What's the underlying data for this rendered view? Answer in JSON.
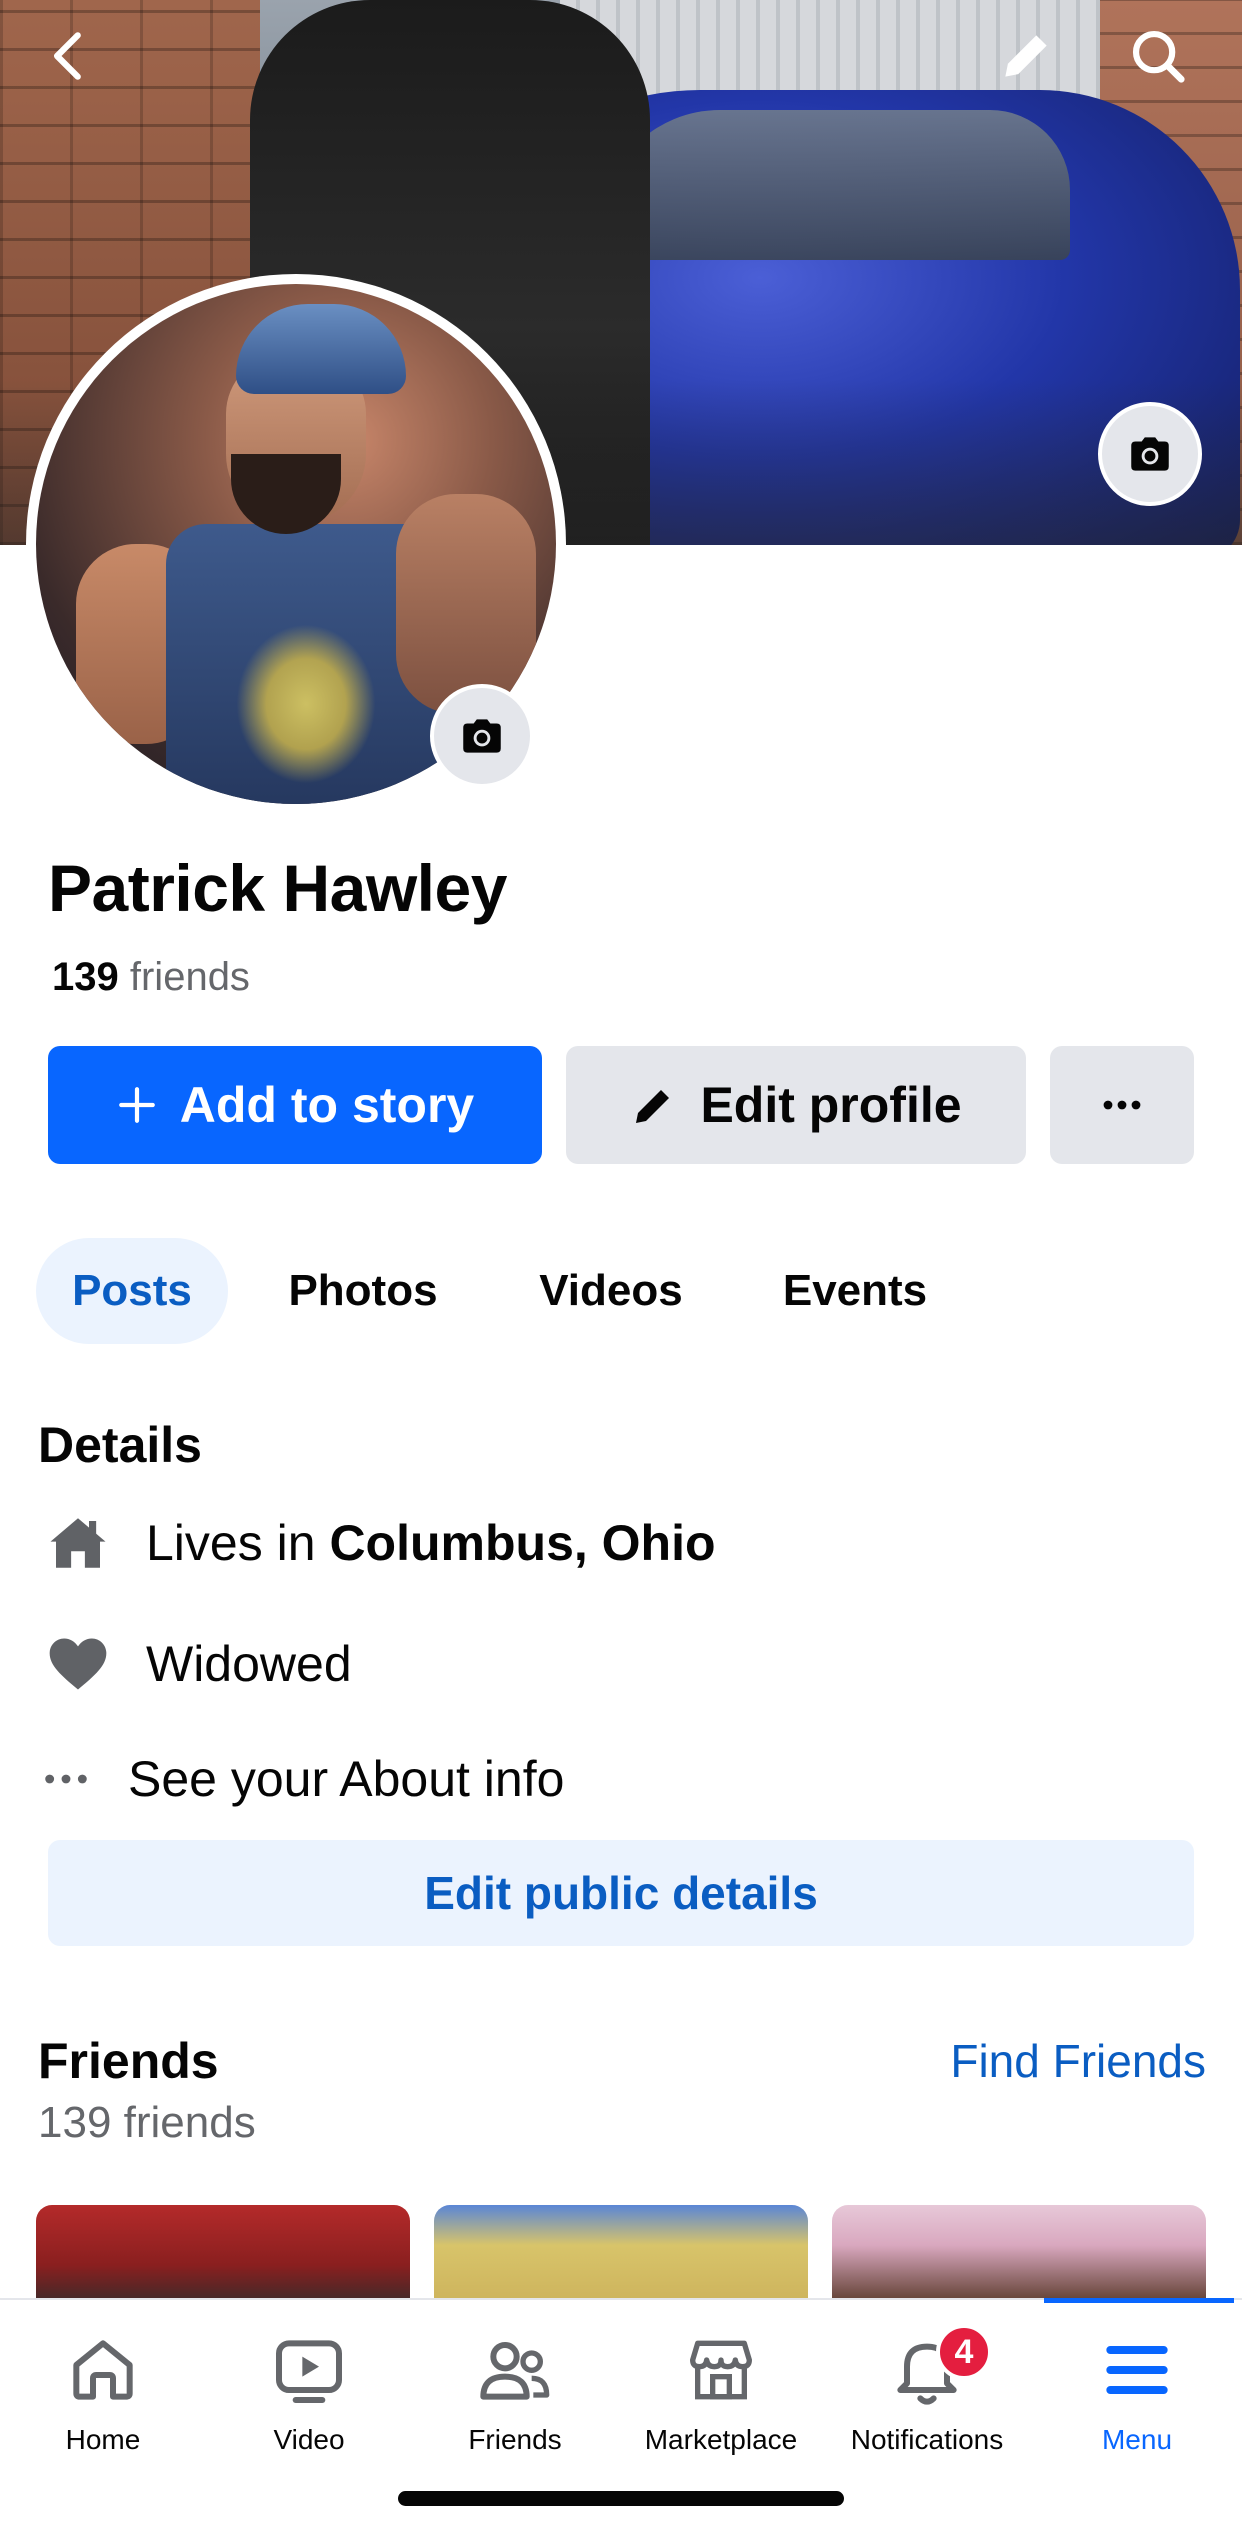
{
  "profile": {
    "name": "Patrick Hawley",
    "friends_number": "139",
    "friends_word": "friends"
  },
  "actions": {
    "add_to_story": "Add to story",
    "edit_profile": "Edit profile",
    "more": "more-options"
  },
  "tabs": [
    {
      "label": "Posts",
      "active": true
    },
    {
      "label": "Photos",
      "active": false
    },
    {
      "label": "Videos",
      "active": false
    },
    {
      "label": "Events",
      "active": false
    }
  ],
  "details": {
    "title": "Details",
    "lives_prefix": "Lives in ",
    "lives_city": "Columbus, Ohio",
    "relationship": "Widowed",
    "about": "See your About info",
    "edit_public": "Edit public details"
  },
  "friends_section": {
    "title": "Friends",
    "find_friends": "Find Friends",
    "count_text": "139 friends"
  },
  "bottom_nav": [
    {
      "label": "Home",
      "icon": "home-icon"
    },
    {
      "label": "Video",
      "icon": "video-icon"
    },
    {
      "label": "Friends",
      "icon": "friends-icon"
    },
    {
      "label": "Marketplace",
      "icon": "marketplace-icon"
    },
    {
      "label": "Notifications",
      "icon": "bell-icon",
      "badge": "4"
    },
    {
      "label": "Menu",
      "icon": "menu-icon",
      "active": true
    }
  ],
  "colors": {
    "primary": "#0866ff",
    "link": "#0a5dc2",
    "secondary_bg": "#e4e6eb",
    "tint_bg": "#ebf3fe",
    "badge": "#e41e3f"
  }
}
